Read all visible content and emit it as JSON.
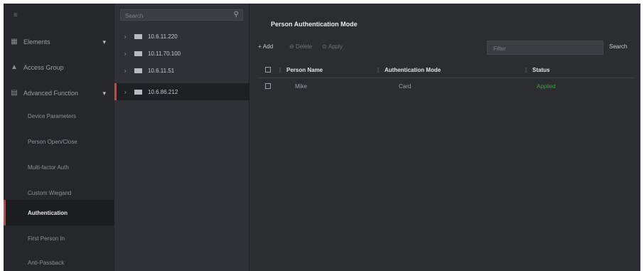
{
  "nav": {
    "items": [
      {
        "label": "Elements",
        "icon": "grid-icon"
      },
      {
        "label": "Access Group",
        "icon": "lock-icon"
      },
      {
        "label": "Advanced Function",
        "icon": "settings-icon"
      }
    ],
    "sub_items": [
      {
        "label": "Device Parameters"
      },
      {
        "label": "Person Open/Close"
      },
      {
        "label": "Multi-factor Auth"
      },
      {
        "label": "Custom Wiegand"
      },
      {
        "label": "Authentication"
      },
      {
        "label": "First Person In"
      },
      {
        "label": "Anti-Passback"
      }
    ]
  },
  "tree": {
    "search_placeholder": "Search",
    "devices": [
      {
        "label": "10.6.11.220"
      },
      {
        "label": "10.11.70.100"
      },
      {
        "label": "10.6.11.51"
      },
      {
        "label": "10.6.86.212"
      }
    ]
  },
  "main": {
    "title": "Person Authentication Mode",
    "toolbar": {
      "add": "Add",
      "delete": "Delete",
      "apply": "Apply",
      "search_placeholder": "Filter",
      "search": "Search"
    },
    "columns": [
      "Person Name",
      "Authentication Mode",
      "Status"
    ],
    "rows": [
      {
        "name": "Mike",
        "mode": "Card",
        "status": "Applied"
      }
    ]
  },
  "colors": {
    "accent": "#d0443d",
    "success": "#3f9d3f"
  }
}
